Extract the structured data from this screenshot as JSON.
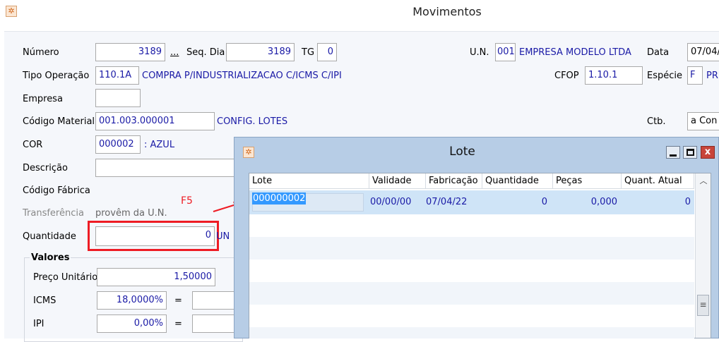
{
  "window": {
    "title": "Movimentos",
    "app_icon": "app-logo-icon"
  },
  "form": {
    "numero_label": "Número",
    "numero_value": "3189",
    "numero_lookup": "...",
    "seq_dia_label": "Seq. Dia",
    "seq_dia_value": "3189",
    "tg_label": "TG",
    "tg_value": "0",
    "un_label": "U.N.",
    "un_code": "001",
    "un_name": "EMPRESA MODELO LTDA",
    "data_label": "Data",
    "data_value": "07/04/",
    "tipo_operacao_label": "Tipo Operação",
    "tipo_operacao_code": "110.1A",
    "tipo_operacao_desc": "COMPRA P/INDUSTRIALIZACAO C/ICMS C/IPI",
    "cfop_label": "CFOP",
    "cfop_value": "1.10.1",
    "especie_label": "Espécie",
    "especie_code": "F",
    "especie_desc": "PR",
    "empresa_label": "Empresa",
    "empresa_value": "",
    "codigo_material_label": "Código Material",
    "codigo_material_value": "001.003.000001",
    "codigo_material_desc": "CONFIG. LOTES",
    "ctb_label": "Ctb.",
    "ctb_value": "a Con",
    "cor_label": "COR",
    "cor_code": "000002",
    "cor_desc": ": AZUL",
    "descricao_label": "Descrição",
    "descricao_value": "",
    "codigo_fabrica_label": "Código Fábrica",
    "transferencia_label": "Transferência",
    "transferencia_desc": "provêm da U.N.",
    "quantidade_label": "Quantidade",
    "quantidade_value": "0",
    "quantidade_unit": "UN",
    "annotation_key": "F5"
  },
  "valores": {
    "title": "Valores",
    "preco_unitario_label": "Preço Unitário",
    "preco_unitario_value": "1,50000",
    "icms_label": "ICMS",
    "icms_value": "18,0000%",
    "icms_eq": "=",
    "ipi_label": "IPI",
    "ipi_value": "0,00%",
    "ipi_eq": "="
  },
  "lote_dialog": {
    "title": "Lote",
    "columns": [
      "Lote",
      "Validade",
      "Fabricação",
      "Quantidade",
      "Peças",
      "Quant. Atual"
    ],
    "rows": [
      {
        "lote": "000000002",
        "validade": "00/00/00",
        "fabricacao": "07/04/22",
        "quantidade": "0",
        "pecas": "0,000",
        "quant_atual": "0"
      }
    ],
    "close_glyph": "x"
  },
  "colors": {
    "accent_red": "#ee1c24",
    "value_blue": "#1a1aa6",
    "dialog_frame": "#b7cde6",
    "selection": "#cfe4f7"
  }
}
